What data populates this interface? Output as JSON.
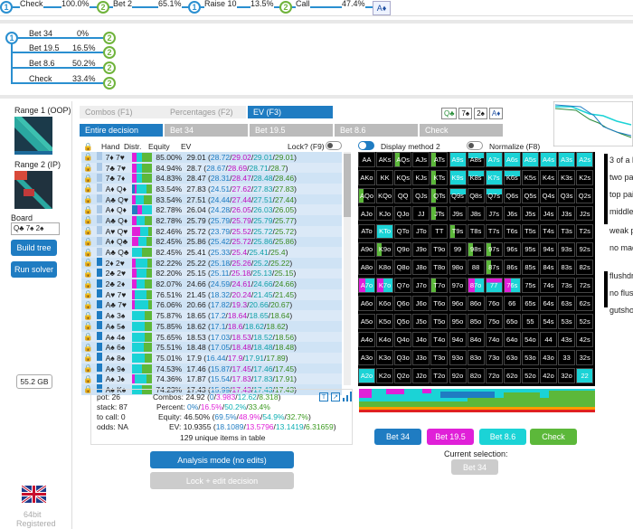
{
  "path": [
    {
      "node": "1",
      "type": "blue",
      "label": "Check",
      "pct": "100.0%"
    },
    {
      "node": "2",
      "type": "green",
      "label": "Bet 2",
      "pct": "65.1%"
    },
    {
      "node": "1",
      "type": "blue",
      "label": "Raise 10",
      "pct": "13.5%"
    },
    {
      "node": "2",
      "type": "green",
      "label": "Call",
      "pct": "47.4%"
    },
    {
      "node": "A♦",
      "type": "end",
      "label": "",
      "pct": ""
    }
  ],
  "tree": {
    "root": "1",
    "branches": [
      {
        "label": "Bet 34",
        "pct": "0%",
        "node": "2"
      },
      {
        "label": "Bet 19.5",
        "pct": "16.5%",
        "node": "2"
      },
      {
        "label": "Bet 8.6",
        "pct": "50.2%",
        "node": "2"
      },
      {
        "label": "Check",
        "pct": "33.4%",
        "node": "2"
      }
    ]
  },
  "sidebar": {
    "range1": "Range 1 (OOP)",
    "range2": "Range 2 (IP)",
    "board_label": "Board",
    "board_value": "Q♣ 7♠ 2♠",
    "build_tree": "Build tree",
    "run_solver": "Run solver",
    "memory": "55.2 GB",
    "bits": "64bit",
    "registered": "Registered"
  },
  "tabs": {
    "combos": "Combos (F1)",
    "percentages": "Percentages (F2)",
    "ev": "EV (F3)"
  },
  "board_cards": [
    "Q♣",
    "7♠",
    "2♠",
    "A♦"
  ],
  "subtabs": [
    "Entire decision",
    "Bet 34",
    "Bet 19.5",
    "Bet 8.6",
    "Check"
  ],
  "table_header": {
    "hand": "Hand",
    "distr": "Distr.",
    "equity": "Equity",
    "ev": "EV",
    "lock": "Lock? (F9)"
  },
  "options": {
    "display": "Display method 2",
    "normalize": "Normalize (F8)"
  },
  "rows": [
    {
      "hand": "7♦ 7♥",
      "eq": "85.00%",
      "ev": "29.01",
      "a": "28.72",
      "b": "29.02",
      "c": "29.01",
      "d": "29.01"
    },
    {
      "hand": "7♣ 7♥",
      "eq": "84.94%",
      "ev": "28.7",
      "a": "28.67",
      "b": "28.69",
      "c": "28.71",
      "d": "28.7"
    },
    {
      "hand": "7♣ 7♦",
      "eq": "84.83%",
      "ev": "28.47",
      "a": "28.31",
      "b": "28.47",
      "c": "28.48",
      "d": "28.46"
    },
    {
      "hand": "A♦ Q♦",
      "eq": "83.54%",
      "ev": "27.83",
      "a": "24.51",
      "b": "27.62",
      "c": "27.83",
      "d": "27.83"
    },
    {
      "hand": "A♣ Q♥",
      "eq": "83.54%",
      "ev": "27.51",
      "a": "24.44",
      "b": "27.44",
      "c": "27.51",
      "d": "27.44"
    },
    {
      "hand": "A♦ Q♦",
      "eq": "82.78%",
      "ev": "26.04",
      "a": "24.28",
      "b": "26.05",
      "c": "26.03",
      "d": "26.05"
    },
    {
      "hand": "A♣ Q♦",
      "eq": "82.78%",
      "ev": "25.79",
      "a": "25.79",
      "b": "25.79",
      "c": "25.79",
      "d": "25.77"
    },
    {
      "hand": "A♥ Q♥",
      "eq": "82.46%",
      "ev": "25.72",
      "a": "23.79",
      "b": "25.52",
      "c": "25.72",
      "d": "25.72"
    },
    {
      "hand": "A♦ Q♣",
      "eq": "82.45%",
      "ev": "25.86",
      "a": "25.42",
      "b": "25.72",
      "c": "25.86",
      "d": "25.86"
    },
    {
      "hand": "A♣ Q♣",
      "eq": "82.45%",
      "ev": "25.41",
      "a": "25.33",
      "b": "25.4",
      "c": "25.41",
      "d": "25.4"
    },
    {
      "hand": "2♦ 2♥",
      "eq": "82.22%",
      "ev": "25.22",
      "a": "25.18",
      "b": "25.26",
      "c": "25.2",
      "d": "25.22"
    },
    {
      "hand": "2♣ 2♥",
      "eq": "82.20%",
      "ev": "25.15",
      "a": "25.11",
      "b": "25.18",
      "c": "25.13",
      "d": "25.15"
    },
    {
      "hand": "2♣ 2♦",
      "eq": "82.07%",
      "ev": "24.66",
      "a": "24.59",
      "b": "24.61",
      "c": "24.66",
      "d": "24.66"
    },
    {
      "hand": "A♥ 7♥",
      "eq": "76.51%",
      "ev": "21.45",
      "a": "18.32",
      "b": "20.24",
      "c": "21.45",
      "d": "21.45"
    },
    {
      "hand": "A♣ 7♥",
      "eq": "76.06%",
      "ev": "20.66",
      "a": "17.82",
      "b": "19.3",
      "c": "20.66",
      "d": "20.67"
    },
    {
      "hand": "A♠ 3♠",
      "eq": "75.87%",
      "ev": "18.65",
      "a": "17.2",
      "b": "18.64",
      "c": "18.65",
      "d": "18.64"
    },
    {
      "hand": "A♠ 5♠",
      "eq": "75.85%",
      "ev": "18.62",
      "a": "17.1",
      "b": "18.6",
      "c": "18.62",
      "d": "18.62"
    },
    {
      "hand": "A♠ 4♠",
      "eq": "75.65%",
      "ev": "18.53",
      "a": "17.03",
      "b": "18.53",
      "c": "18.52",
      "d": "18.56"
    },
    {
      "hand": "A♠ 6♠",
      "eq": "75.51%",
      "ev": "18.48",
      "a": "17.05",
      "b": "18.48",
      "c": "18.48",
      "d": "18.48"
    },
    {
      "hand": "A♠ 8♠",
      "eq": "75.01%",
      "ev": "17.9",
      "a": "16.44",
      "b": "17.9",
      "c": "17.91",
      "d": "17.89"
    },
    {
      "hand": "A♠ 9♠",
      "eq": "74.53%",
      "ev": "17.46",
      "a": "15.87",
      "b": "17.45",
      "c": "17.46",
      "d": "17.45"
    },
    {
      "hand": "A♠ J♠",
      "eq": "74.36%",
      "ev": "17.87",
      "a": "15.54",
      "b": "17.83",
      "c": "17.83",
      "d": "17.91"
    },
    {
      "hand": "A♠ K♠",
      "eq": "74.23%",
      "ev": "17.43",
      "a": "15.99",
      "b": "17.43",
      "c": "17.43",
      "d": "17.43"
    }
  ],
  "summary": {
    "pot": "pot: 26",
    "stack": "stack: 87",
    "tocall": "to call: 0",
    "odds": "odds: NA",
    "combos_label": "Combos:",
    "combos_total": "24.92",
    "combos": [
      "0",
      "3.983",
      "12.62",
      "8.318"
    ],
    "percent_label": "Percent:",
    "percent": [
      "0%",
      "16.5%",
      "50.2%",
      "33.4%"
    ],
    "equity_label": "Equity:",
    "equity_total": "46.50%",
    "equity": [
      "69.5%",
      "48.9%",
      "54.9%",
      "32.7%"
    ],
    "ev_label": "EV:",
    "ev_total": "10.9355",
    "ev": [
      "18.1089",
      "13.5796",
      "13.1419",
      "6.31659"
    ],
    "unique": "129 unique items in table"
  },
  "analysis_button": "Analysis mode (no edits)",
  "lock_button": "Lock + edit decision",
  "actions": [
    {
      "label": "Bet 34",
      "color": "#1f7cc2"
    },
    {
      "label": "Bet 19.5",
      "color": "#e020d8"
    },
    {
      "label": "Bet 8.6",
      "color": "#1bd3d6"
    },
    {
      "label": "Check",
      "color": "#5cb83a"
    }
  ],
  "current_selection": "Current selection:",
  "current_value": "Bet 34",
  "grid_ranks": [
    "A",
    "K",
    "Q",
    "J",
    "T",
    "9",
    "8",
    "7",
    "6",
    "5",
    "4",
    "3",
    "2"
  ],
  "right_panel": [
    "3 of a ki",
    "two pa",
    "top pai",
    "middle",
    "weak p",
    "no mad",
    "flushdr",
    "no flusl",
    "gutsho"
  ],
  "colors": {
    "bet34": "#1f7cc2",
    "bet195": "#e020d8",
    "bet86": "#1bd3d6",
    "check": "#5cb83a",
    "tree_blue": "#2a8fd0",
    "tree_green": "#6fb33b"
  }
}
